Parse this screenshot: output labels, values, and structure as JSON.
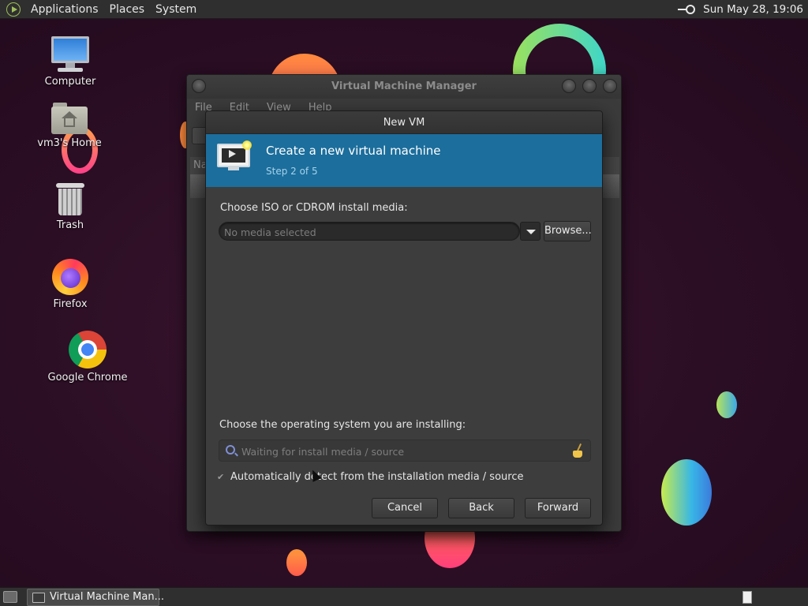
{
  "top_panel": {
    "menus": [
      "Applications",
      "Places",
      "System"
    ],
    "clock": "Sun May 28, 19:06",
    "tray_icon": "key-icon"
  },
  "desktop": {
    "icons": [
      {
        "label": "Computer",
        "icon": "computer-icon"
      },
      {
        "label": "vm3's Home",
        "icon": "home-folder-icon"
      },
      {
        "label": "Trash",
        "icon": "trash-icon"
      },
      {
        "label": "Firefox",
        "icon": "firefox-icon"
      },
      {
        "label": "Google Chrome",
        "icon": "chrome-icon"
      }
    ]
  },
  "vmm_window": {
    "title": "Virtual Machine Manager",
    "menus": [
      "File",
      "Edit",
      "View",
      "Help"
    ],
    "column_header": "Na"
  },
  "new_vm_dialog": {
    "title": "New VM",
    "header_title": "Create a new virtual machine",
    "step": "Step 2 of 5",
    "media_label": "Choose ISO or CDROM install media:",
    "media_placeholder": "No media selected",
    "browse_label": "Browse...",
    "os_label": "Choose the operating system you are installing:",
    "os_placeholder": "Waiting for install media / source",
    "auto_detect_label": "Automatically detect from the installation media / source",
    "auto_detect_checked": true,
    "buttons": {
      "cancel": "Cancel",
      "back": "Back",
      "forward": "Forward"
    }
  },
  "taskbar": {
    "tasks": [
      {
        "label": "Virtual Machine Man..."
      }
    ]
  },
  "colors": {
    "header_blue": "#1c6e9c",
    "panel": "#2f2f2f",
    "dialog": "#3d3d3d",
    "desktop": "#2b0e24"
  }
}
